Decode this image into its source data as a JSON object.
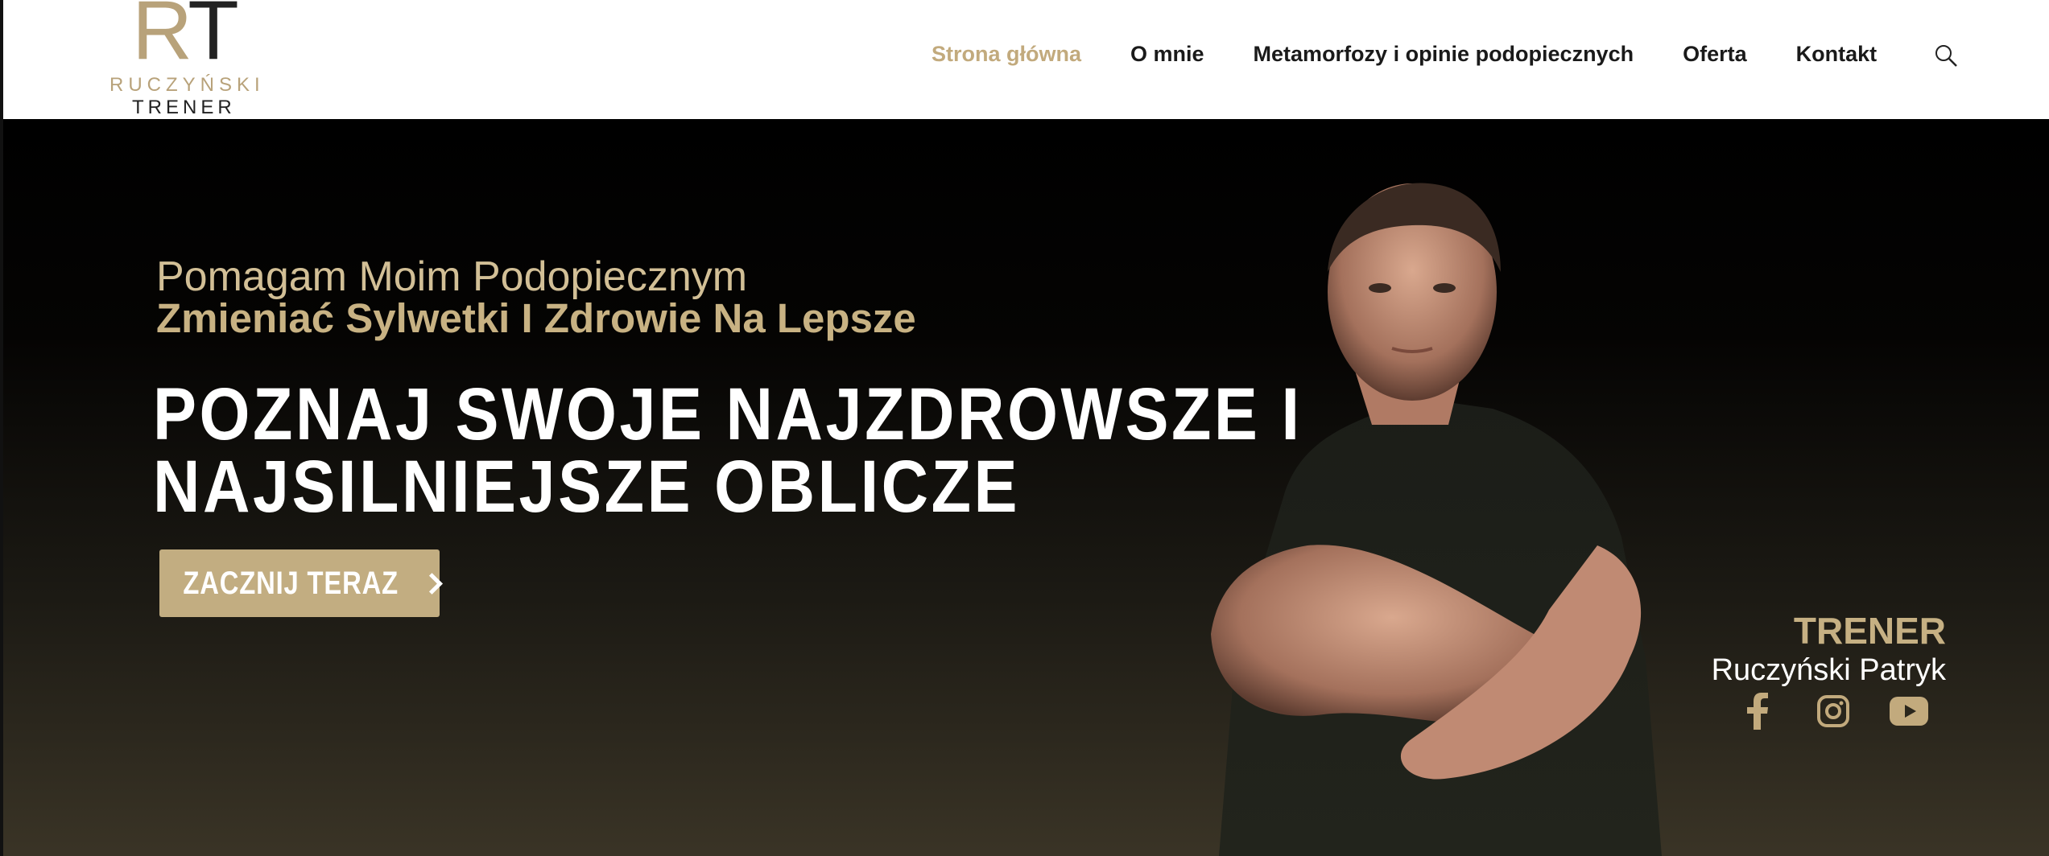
{
  "brand": {
    "logo_monogram_r": "R",
    "logo_monogram_t": "T",
    "logo_line1": "RUCZYŃSKI",
    "logo_line2": "TRENER",
    "accent": "#c2aa7d"
  },
  "nav": {
    "items": [
      {
        "label": "Strona główna",
        "active": true
      },
      {
        "label": "O mnie"
      },
      {
        "label": "Metamorfozy i opinie podopiecznych"
      },
      {
        "label": "Oferta"
      },
      {
        "label": "Kontakt"
      }
    ],
    "search_icon": "search-icon"
  },
  "hero": {
    "subhead_line1": "Pomagam Moim Podopiecznym",
    "subhead_line2": "Zmieniać Sylwetki I Zdrowie Na Lepsze",
    "headline_line1": "POZNAJ SWOJE NAJZDROWSZE I",
    "headline_line2": "NAJSILNIEJSZE OBLICZE",
    "cta_label": "ZACZNIJ TERAZ"
  },
  "trainer": {
    "title": "TRENER",
    "name": "Ruczyński Patryk",
    "socials": [
      "facebook-icon",
      "instagram-icon",
      "youtube-icon"
    ]
  }
}
